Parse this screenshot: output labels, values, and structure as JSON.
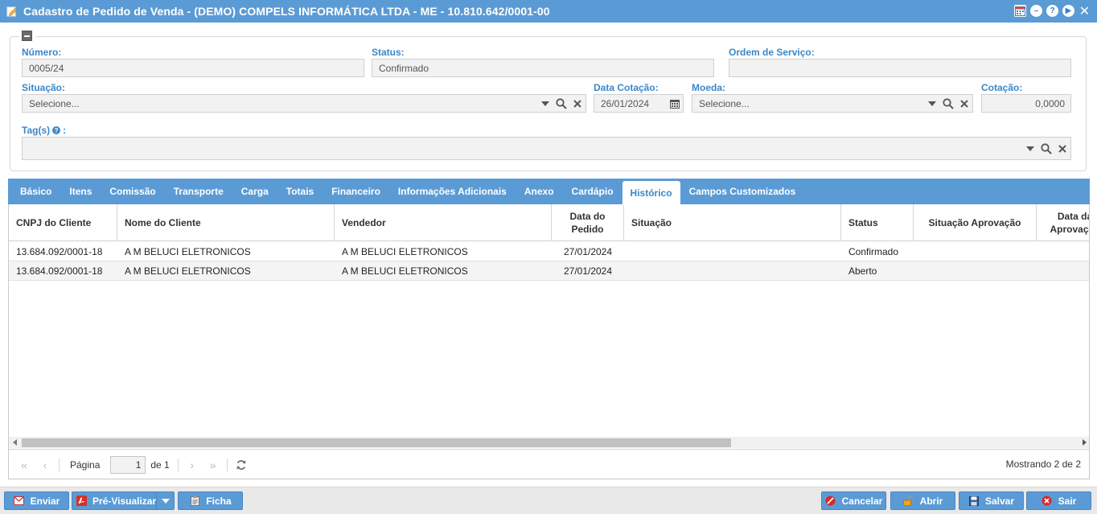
{
  "window": {
    "title": "Cadastro de Pedido de Venda - (DEMO) COMPELS INFORMÁTICA LTDA - ME - 10.810.642/0001-00"
  },
  "form": {
    "numero": {
      "label": "Número:",
      "value": "0005/24"
    },
    "status": {
      "label": "Status:",
      "value": "Confirmado"
    },
    "ordem_servico": {
      "label": "Ordem de Serviço:",
      "value": ""
    },
    "situacao": {
      "label": "Situação:",
      "placeholder": "Selecione..."
    },
    "data_cotacao": {
      "label": "Data Cotação:",
      "value": "26/01/2024"
    },
    "moeda": {
      "label": "Moeda:",
      "placeholder": "Selecione..."
    },
    "cotacao": {
      "label": "Cotação:",
      "value": "0,0000"
    },
    "tags": {
      "label": "Tag(s)",
      "suffix": ":",
      "value": ""
    }
  },
  "tabs": [
    {
      "label": "Básico",
      "active": false
    },
    {
      "label": "Itens",
      "active": false
    },
    {
      "label": "Comissão",
      "active": false
    },
    {
      "label": "Transporte",
      "active": false
    },
    {
      "label": "Carga",
      "active": false
    },
    {
      "label": "Totais",
      "active": false
    },
    {
      "label": "Financeiro",
      "active": false
    },
    {
      "label": "Informações Adicionais",
      "active": false
    },
    {
      "label": "Anexo",
      "active": false
    },
    {
      "label": "Cardápio",
      "active": false
    },
    {
      "label": "Histórico",
      "active": true
    },
    {
      "label": "Campos Customizados",
      "active": false
    }
  ],
  "grid": {
    "columns": [
      "CNPJ do Cliente",
      "Nome do Cliente",
      "Vendedor",
      "Data do Pedido",
      "Situação",
      "Status",
      "Situação Aprovação",
      "Data da Aprovação"
    ],
    "rows": [
      [
        "13.684.092/0001-18",
        "A M BELUCI ELETRONICOS",
        "A M BELUCI ELETRONICOS",
        "27/01/2024",
        "",
        "Confirmado",
        "",
        ""
      ],
      [
        "13.684.092/0001-18",
        "A M BELUCI ELETRONICOS",
        "A M BELUCI ELETRONICOS",
        "27/01/2024",
        "",
        "Aberto",
        "",
        ""
      ]
    ]
  },
  "pager": {
    "page_label": "Página",
    "page_value": "1",
    "of_label": "de 1",
    "info": "Mostrando 2 de 2"
  },
  "footer": {
    "enviar": "Enviar",
    "pre_visualizar": "Pré-Visualizar",
    "ficha": "Ficha",
    "cancelar": "Cancelar",
    "abrir": "Abrir",
    "salvar": "Salvar",
    "sair": "Sair"
  },
  "colors": {
    "accent": "#5b9bd5",
    "label": "#3b87c8",
    "cancel_icon": "#d62b2b",
    "exit_icon": "#d62b2b",
    "open_icon": "#f0a623"
  }
}
